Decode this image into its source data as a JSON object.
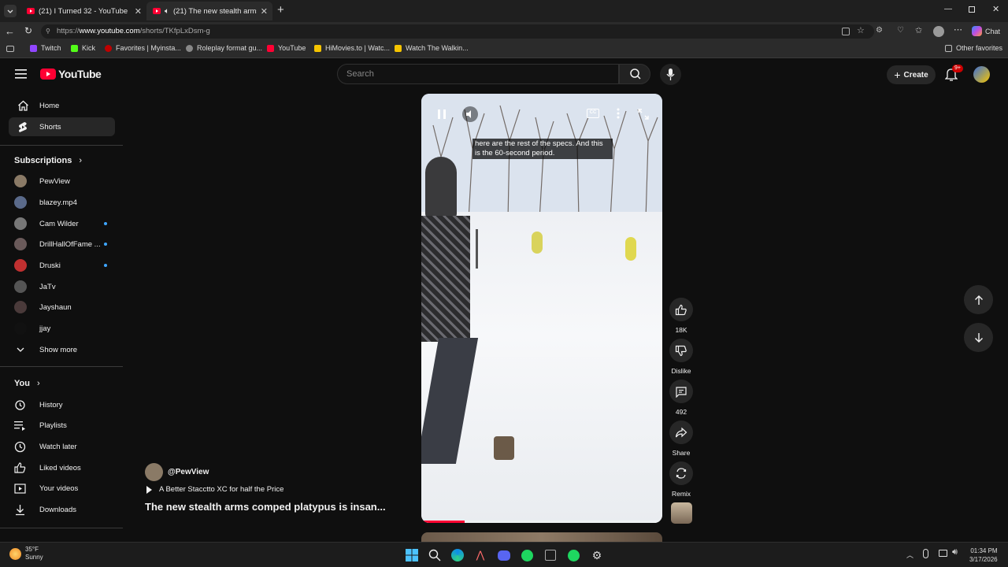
{
  "browser": {
    "tabs": [
      {
        "title": "(21) I Turned 32 - YouTube",
        "active": false
      },
      {
        "title": "(21) The new stealth arms comp",
        "active": true
      }
    ],
    "url": "https://www.youtube.com/shorts/TKfpLxDsm-g",
    "url_prefix": "https://",
    "url_domain": "www.youtube.com",
    "url_path": "/shorts/TKfpLxDsm-g",
    "chat_label": "Chat",
    "bookmarks": [
      {
        "label": "Twitch",
        "color": "#9146ff"
      },
      {
        "label": "Kick",
        "color": "#53fc18"
      },
      {
        "label": "Favorites | Myinsta...",
        "color": "#c00000"
      },
      {
        "label": "Roleplay format gu...",
        "color": "#888888"
      },
      {
        "label": "YouTube",
        "color": "#ff0033"
      },
      {
        "label": "HiMovies.to | Watc...",
        "color": "#f5c400"
      },
      {
        "label": "Watch The Walkin...",
        "color": "#f5c400"
      }
    ],
    "other_favorites": "Other favorites"
  },
  "header": {
    "logo": "YouTube",
    "search_placeholder": "Search",
    "create_label": "Create",
    "notif_badge": "9+"
  },
  "sidebar": {
    "top": [
      {
        "label": "Home",
        "icon": "home-icon",
        "active": false
      },
      {
        "label": "Shorts",
        "icon": "shorts-icon",
        "active": true
      }
    ],
    "subscriptions_title": "Subscriptions",
    "subscriptions": [
      {
        "label": "PewView",
        "color": "#8a7a66",
        "new": false
      },
      {
        "label": "blazey.mp4",
        "color": "#5a6a8a",
        "new": false
      },
      {
        "label": "Cam Wilder",
        "color": "#777777",
        "new": true
      },
      {
        "label": "DrillHallOfFame ...",
        "color": "#6a5a5a",
        "new": true
      },
      {
        "label": "Druski",
        "color": "#c03030",
        "new": false
      },
      {
        "label": "JaTv",
        "color": "#555555",
        "new": false
      },
      {
        "label": "Jayshaun",
        "color": "#4a3a3a",
        "new": false
      },
      {
        "label": "jjay",
        "color": "#111111",
        "new": false
      }
    ],
    "show_more": "Show more",
    "you_title": "You",
    "you_items": [
      {
        "label": "History",
        "icon": "history-icon"
      },
      {
        "label": "Playlists",
        "icon": "playlists-icon"
      },
      {
        "label": "Watch later",
        "icon": "watch-later-icon"
      },
      {
        "label": "Liked videos",
        "icon": "liked-videos-icon"
      },
      {
        "label": "Your videos",
        "icon": "your-videos-icon"
      },
      {
        "label": "Downloads",
        "icon": "downloads-icon"
      }
    ]
  },
  "short": {
    "caption": "here are the rest of the specs. And this is the 60-second period.",
    "progress": 0.18,
    "channel": "@PewView",
    "music": "A Better Stacctto XC for half the Price",
    "title": "The new stealth arms comped platypus is insan..."
  },
  "actions": {
    "like_count": "18K",
    "dislike_label": "Dislike",
    "comment_count": "492",
    "share_label": "Share",
    "remix_label": "Remix"
  },
  "taskbar": {
    "weather_temp": "35°F",
    "weather_desc": "Sunny",
    "time": "01:34 PM",
    "date": "3/17/2026"
  }
}
